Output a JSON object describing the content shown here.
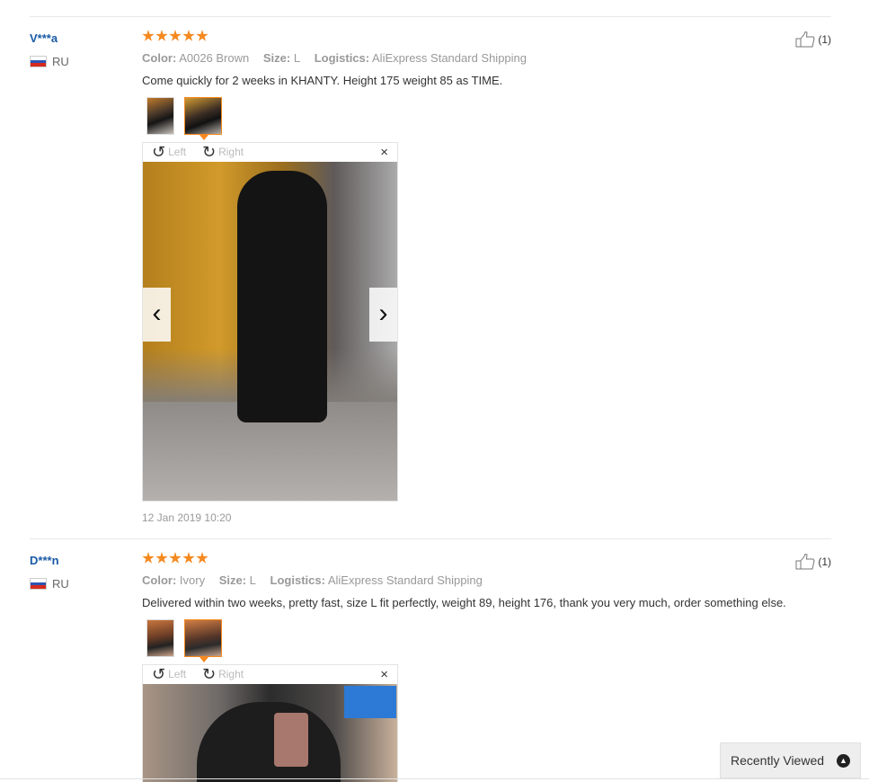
{
  "reviews": [
    {
      "user": "V***a",
      "country": "RU",
      "rating": 5,
      "attrs": {
        "color_label": "Color:",
        "color_value": "A0026 Brown",
        "size_label": "Size:",
        "size_value": "L",
        "logistics_label": "Logistics:",
        "logistics_value": "AliExpress Standard Shipping"
      },
      "text": "Come quickly for 2 weeks in KHANTY. Height 175 weight 85 as TIME.",
      "useful_count": "(1)",
      "viewer": {
        "rotate_left": "Left",
        "rotate_right": "Right",
        "close": "×",
        "prev": "‹",
        "next": "›"
      },
      "date": "12 Jan 2019 10:20"
    },
    {
      "user": "D***n",
      "country": "RU",
      "rating": 5,
      "attrs": {
        "color_label": "Color:",
        "color_value": "Ivory",
        "size_label": "Size:",
        "size_value": "L",
        "logistics_label": "Logistics:",
        "logistics_value": "AliExpress Standard Shipping"
      },
      "text": "Delivered within two weeks, pretty fast, size L fit perfectly, weight 89, height 176, thank you very much, order something else.",
      "useful_count": "(1)",
      "viewer": {
        "rotate_left": "Left",
        "rotate_right": "Right",
        "close": "×"
      }
    }
  ],
  "recently_viewed": {
    "label": "Recently Viewed",
    "icon": "chevron-up-icon"
  },
  "colors": {
    "link": "#1a5aa6",
    "star": "#f5891f",
    "muted": "#999999"
  }
}
